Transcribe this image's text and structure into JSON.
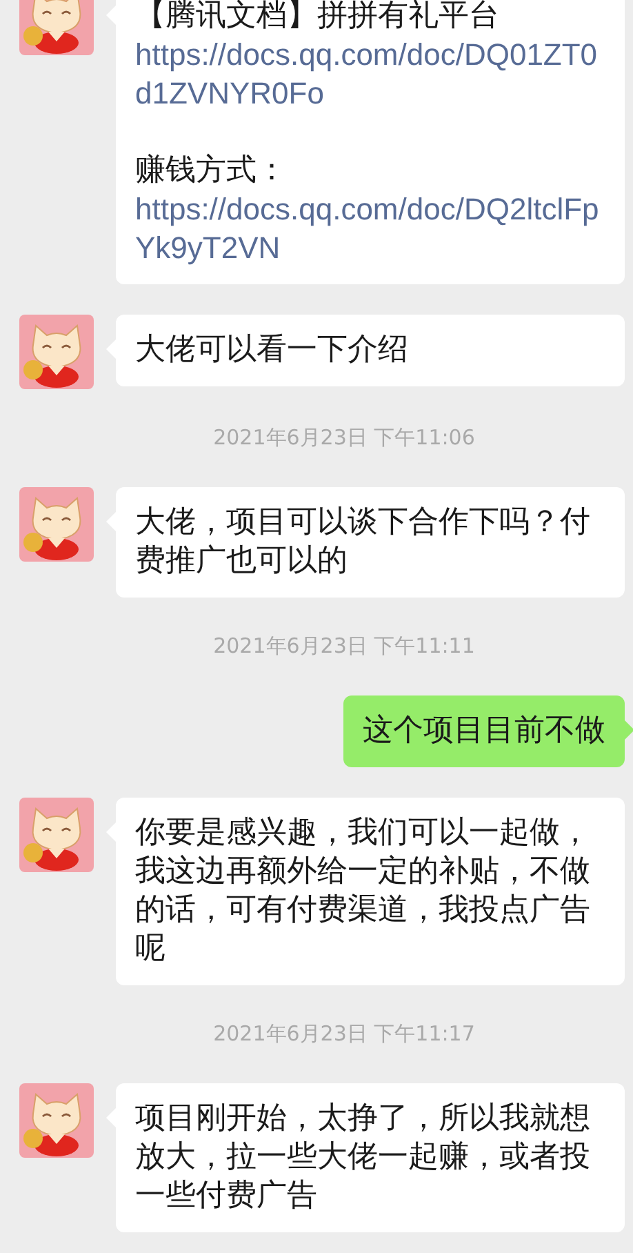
{
  "messages": [
    {
      "kind": "message",
      "outgoing": false,
      "parts": [
        {
          "kind": "text",
          "text": "【腾讯文档】拼拼有礼平台"
        },
        {
          "kind": "link",
          "text": "https://docs.qq.com/doc/DQ01ZT0d1ZVNYR0Fo"
        },
        {
          "kind": "text",
          "text": "赚钱方式："
        },
        {
          "kind": "link",
          "text": "https://docs.qq.com/doc/DQ2ltclFpYk9yT2VN"
        }
      ]
    },
    {
      "kind": "message",
      "outgoing": false,
      "parts": [
        {
          "kind": "text",
          "text": "大佬可以看一下介绍"
        }
      ]
    },
    {
      "kind": "timestamp",
      "text": "2021年6月23日 下午11:06"
    },
    {
      "kind": "message",
      "outgoing": false,
      "parts": [
        {
          "kind": "text",
          "text": "大佬，项目可以谈下合作下吗？付费推广也可以的"
        }
      ]
    },
    {
      "kind": "timestamp",
      "text": "2021年6月23日 下午11:11"
    },
    {
      "kind": "message",
      "outgoing": true,
      "parts": [
        {
          "kind": "text",
          "text": "这个项目目前不做"
        }
      ]
    },
    {
      "kind": "message",
      "outgoing": false,
      "parts": [
        {
          "kind": "text",
          "text": "你要是感兴趣，我们可以一起做，我这边再额外给一定的补贴，不做的话，可有付费渠道，我投点广告呢"
        }
      ]
    },
    {
      "kind": "timestamp",
      "text": "2021年6月23日 下午11:17"
    },
    {
      "kind": "message",
      "outgoing": false,
      "parts": [
        {
          "kind": "text",
          "text": "项目刚开始，太挣了，所以我就想放大，拉一些大佬一起赚，或者投一些付费广告"
        }
      ]
    }
  ]
}
